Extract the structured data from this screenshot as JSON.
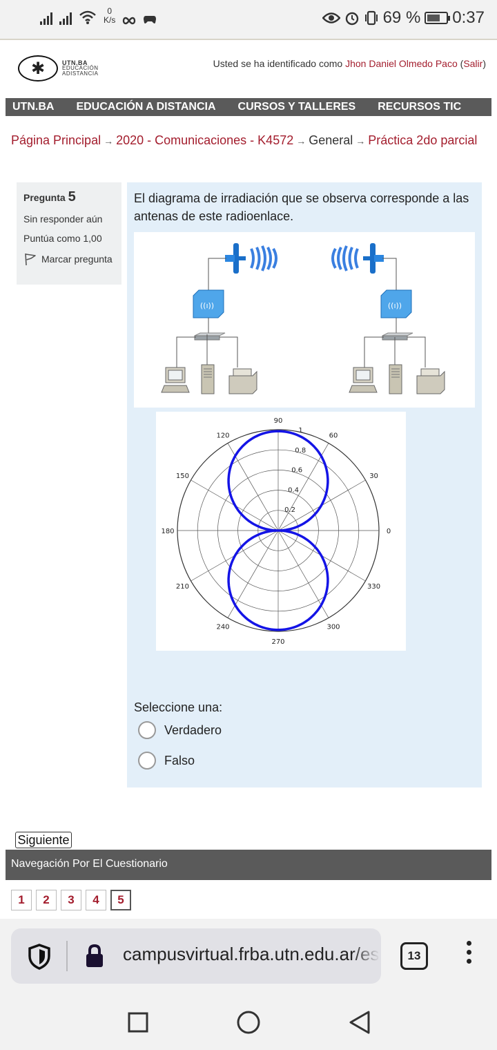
{
  "status_bar": {
    "speed_value": "0",
    "speed_unit": "K/s",
    "battery": "69 %",
    "time": "0:37"
  },
  "header": {
    "logo_line1": "UTN.BA",
    "logo_line2": "EDUCACIÓN",
    "logo_line3": "ADISTANCIA",
    "login_prefix": "Usted se ha identificado como ",
    "user_name": "Jhon Daniel Olmedo Paco",
    "logout_label": "Salir"
  },
  "main_nav": [
    "UTN.BA",
    "EDUCACIÓN A DISTANCIA",
    "CURSOS Y TALLERES",
    "RECURSOS TIC"
  ],
  "breadcrumb": {
    "home": "Página Principal",
    "course": "2020 - Comunicaciones - K4572",
    "section": "General",
    "activity": "Práctica 2do parcial"
  },
  "question_info": {
    "label": "Pregunta",
    "number": "5",
    "state": "Sin responder aún",
    "grade": "Puntúa como 1,00",
    "flag_label": "Marcar pregunta"
  },
  "question": {
    "text": "El diagrama de irradiación que se observa corresponde a las antenas de este radioenlace.",
    "prompt": "Seleccione una:",
    "options": [
      "Verdadero",
      "Falso"
    ]
  },
  "polar_plot": {
    "angle_labels": [
      "0",
      "30",
      "60",
      "90",
      "120",
      "150",
      "180",
      "210",
      "240",
      "270",
      "300",
      "330"
    ],
    "radius_labels": [
      "0.2",
      "0.4",
      "0.6",
      "0.8",
      "1"
    ],
    "pattern_color": "#1414e6"
  },
  "footer": {
    "next_label": "Siguiente",
    "nav_title": "Navegación Por El Cuestionario",
    "pages": [
      "1",
      "2",
      "3",
      "4",
      "5"
    ],
    "current_page": "5"
  },
  "browser": {
    "url": "campusvirtual.frba.utn.edu.ar/esp",
    "tab_count": "13"
  },
  "colors": {
    "link": "#a31d2d",
    "nav_bg": "#5a5a5a",
    "question_bg": "#e3eff9"
  }
}
